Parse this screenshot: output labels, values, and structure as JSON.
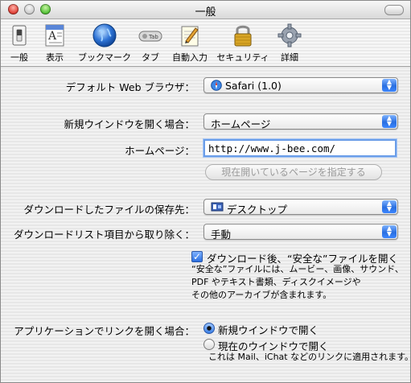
{
  "window": {
    "title": "一般"
  },
  "toolbar": {
    "items": [
      {
        "label": "一般",
        "icon": "switch-icon"
      },
      {
        "label": "表示",
        "icon": "text-icon"
      },
      {
        "label": "ブックマーク",
        "icon": "globe-icon"
      },
      {
        "label": "タブ",
        "icon": "tab-icon"
      },
      {
        "label": "自動入力",
        "icon": "pencil-icon"
      },
      {
        "label": "セキュリティ",
        "icon": "lock-icon"
      },
      {
        "label": "詳細",
        "icon": "gear-icon"
      }
    ]
  },
  "prefs": {
    "default_browser_label": "デフォルト Web ブラウザ：",
    "default_browser_value": "Safari (1.0)",
    "new_window_label": "新規ウインドウを開く場合：",
    "new_window_value": "ホームページ",
    "homepage_label": "ホームページ：",
    "homepage_value": "http://www.j-bee.com/",
    "set_current_page_button": "現在開いているページを指定する",
    "download_location_label": "ダウンロードしたファイルの保存先：",
    "download_location_value": "デスクトップ",
    "remove_downloads_label": "ダウンロードリスト項目から取り除く：",
    "remove_downloads_value": "手動",
    "open_safe_files_label": "ダウンロード後、“安全な”ファイルを開く",
    "safe_files_note_1": "“安全な”ファイルには、ムービー、画像、サウンド、",
    "safe_files_note_2": "PDF やテキスト書類、ディスクイメージや",
    "safe_files_note_3": "その他のアーカイブが含まれます。",
    "open_links_label": "アプリケーションでリンクを開く場合：",
    "open_links_option_1": "新規ウインドウで開く",
    "open_links_option_2": "現在のウインドウで開く",
    "open_links_note": "これは Mail、iChat などのリンクに適用されます。"
  }
}
